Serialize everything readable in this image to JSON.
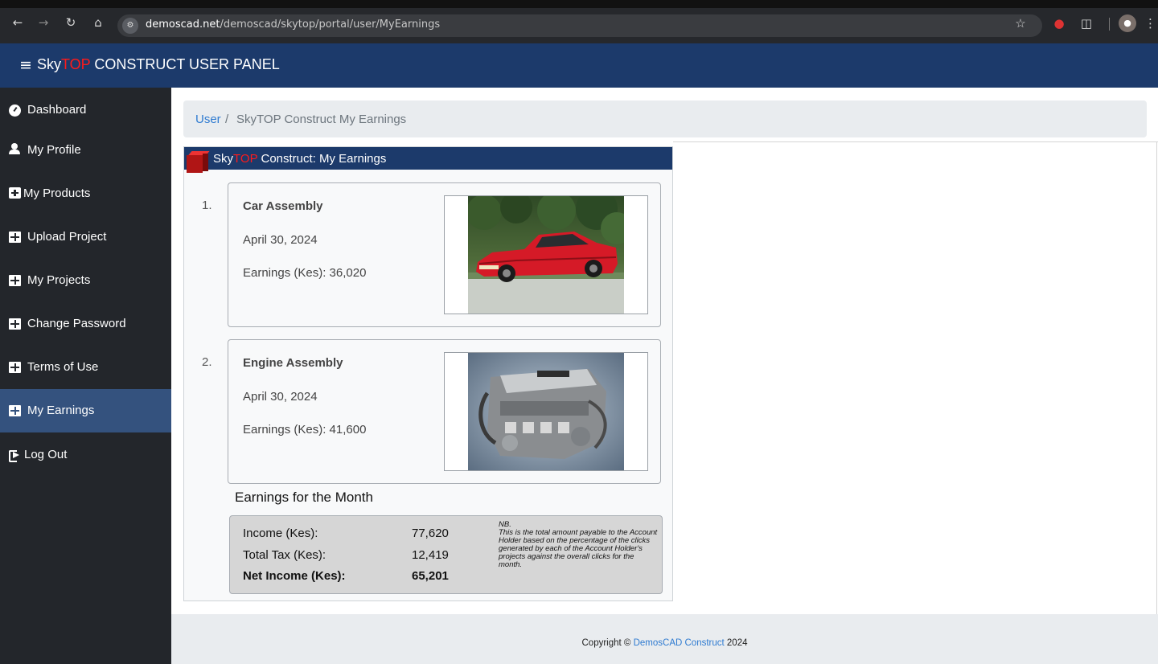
{
  "browser": {
    "url_host": "demoscad.net",
    "url_path": "/demoscad/skytop/portal/user/MyEarnings"
  },
  "header": {
    "brand_sky": "Sky",
    "brand_top": "TOP",
    "brand_rest": " CONSTRUCT USER PANEL"
  },
  "sidebar": {
    "items": [
      {
        "label": "Dashboard",
        "icon": "dashboard-icon"
      },
      {
        "label": "My Profile",
        "icon": "user-icon"
      },
      {
        "label": "My Products",
        "icon": "plus-square-icon"
      },
      {
        "label": "Upload Project",
        "icon": "table-icon"
      },
      {
        "label": "My Projects",
        "icon": "table-icon"
      },
      {
        "label": "Change Password",
        "icon": "table-icon"
      },
      {
        "label": "Terms of Use",
        "icon": "table-icon"
      },
      {
        "label": "My Earnings",
        "icon": "table-icon",
        "active": true
      },
      {
        "label": "Log Out",
        "icon": "sign-out-icon"
      }
    ]
  },
  "breadcrumb": {
    "link": "User",
    "separator": "/",
    "current": "SkyTOP Construct My Earnings"
  },
  "card": {
    "title_sky": "Sky",
    "title_top": "TOP",
    "title_rest": " Construct: My Earnings"
  },
  "projects": [
    {
      "index": "1.",
      "name": "Car Assembly",
      "date": "April 30, 2024",
      "earnings": "Earnings (Kes): 36,020"
    },
    {
      "index": "2.",
      "name": "Engine Assembly",
      "date": "April 30, 2024",
      "earnings": "Earnings (Kes): 41,600"
    }
  ],
  "summary": {
    "title": "Earnings for the Month",
    "income_label": "Income (Kes):",
    "income_value": "77,620",
    "tax_label": "Total Tax (Kes):",
    "tax_value": "12,419",
    "net_label": "Net Income (Kes):",
    "net_value": "65,201",
    "note_title": "NB.",
    "note_body": "This is the total amount payable to the Account Holder based on the percentage of the clicks generated by each of the Account Holder's projects against the overall clicks for the month."
  },
  "footer": {
    "prefix": "Copyright © ",
    "link": "DemosCAD Construct",
    "suffix": " 2024"
  },
  "colors": {
    "header_bg": "#1c3a6b",
    "sidebar_bg": "#23262b",
    "active_bg": "#34527e",
    "accent_red": "#ff1a1a",
    "link_blue": "#2f7bd1"
  }
}
